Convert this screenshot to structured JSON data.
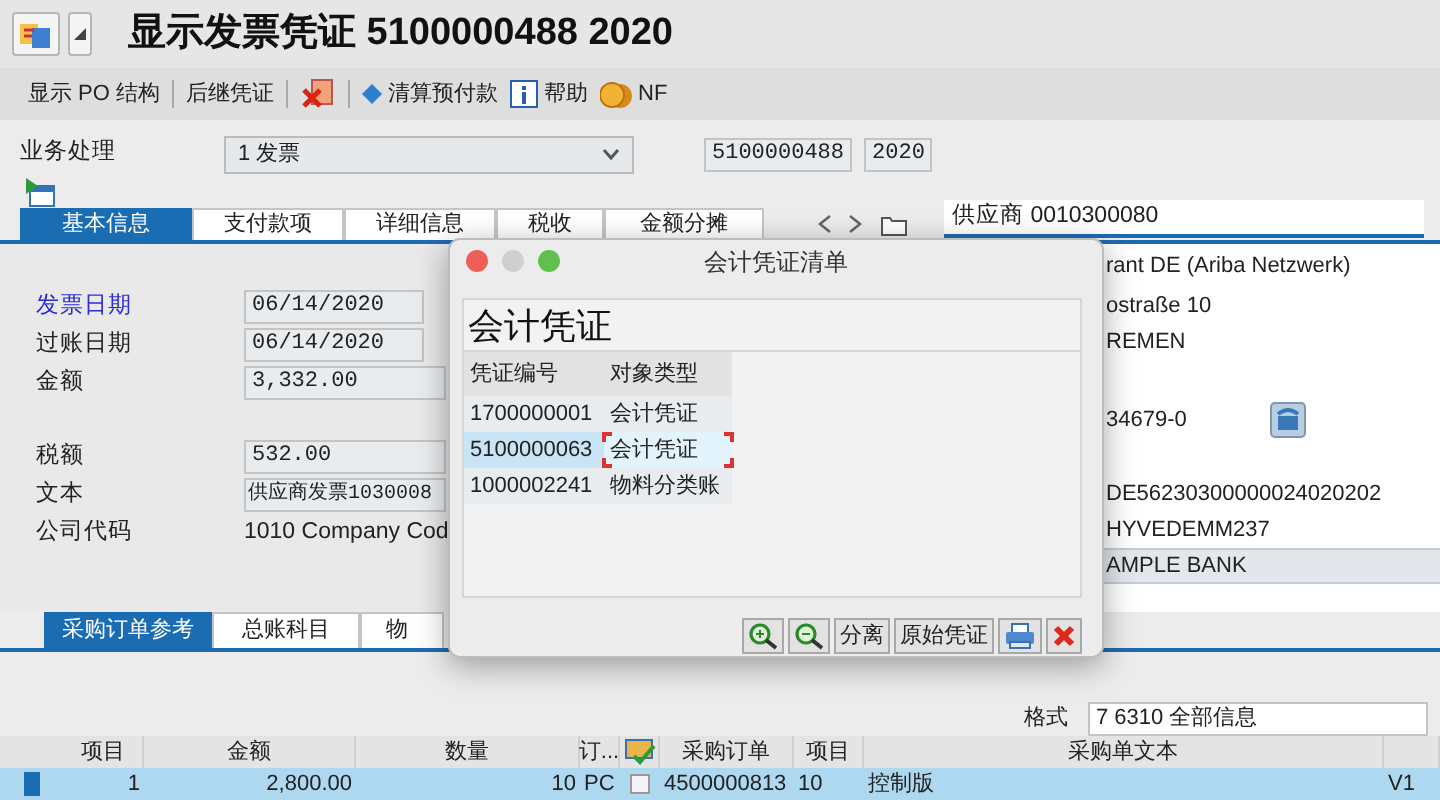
{
  "window": {
    "title": "显示发票凭证 5100000488 2020"
  },
  "toolbar": [
    {
      "kind": "text",
      "label": "显示 PO 结构"
    },
    {
      "kind": "separator"
    },
    {
      "kind": "text",
      "label": "后继凭证"
    },
    {
      "kind": "separator"
    },
    {
      "kind": "delete-icon"
    },
    {
      "kind": "separator"
    },
    {
      "kind": "diamond",
      "label": "清算预付款"
    },
    {
      "kind": "info",
      "label": "帮助"
    },
    {
      "kind": "coins",
      "label": "NF"
    }
  ],
  "header": {
    "transaction_label": "业务处理",
    "transaction_value": "1 发票",
    "doc_number": "5100000488",
    "year": "2020"
  },
  "tabs": [
    {
      "label": "基本信息",
      "selected": true
    },
    {
      "label": "支付款项",
      "selected": false
    },
    {
      "label": "详细信息",
      "selected": false
    },
    {
      "label": "税收",
      "selected": false
    },
    {
      "label": "金额分摊",
      "selected": false
    }
  ],
  "fields": [
    {
      "label": "发票日期",
      "value": "06/14/2020",
      "kind": "input",
      "required": true
    },
    {
      "label": "过账日期",
      "value": "06/14/2020",
      "kind": "input",
      "required": false
    },
    {
      "label": "金额",
      "value": "3,332.00",
      "kind": "input",
      "required": false
    },
    {
      "label": "税额",
      "value": "532.00",
      "kind": "input",
      "required": false
    },
    {
      "label": "文本",
      "value": "供应商发票1030008",
      "kind": "input",
      "required": false
    },
    {
      "label": "公司代码",
      "value": "1010 Company Cod",
      "kind": "text",
      "required": false
    }
  ],
  "vendor": {
    "field": "供应商 0010300080",
    "lines": [
      {
        "kind": "text",
        "text": "rant DE (Ariba Netzwerk)"
      },
      {
        "kind": "text",
        "text": "ostraße 10"
      },
      {
        "kind": "text",
        "text": "REMEN"
      },
      {
        "kind": "text-icon",
        "text": "34679-0"
      },
      {
        "kind": "text",
        "text": "DE56230300000024020202"
      },
      {
        "kind": "text",
        "text": "HYVEDEMM237"
      },
      {
        "kind": "highlight",
        "text": "AMPLE BANK"
      }
    ]
  },
  "dialog": {
    "title": "会计凭证清单",
    "heading": "会计凭证",
    "columns": [
      "凭证编号",
      "对象类型"
    ],
    "rows": [
      {
        "cells": [
          "1700000001",
          "会计凭证"
        ],
        "selected": false
      },
      {
        "cells": [
          "5100000063",
          "会计凭证"
        ],
        "selected": true
      },
      {
        "cells": [
          "1000002241",
          "物料分类账"
        ],
        "selected": false
      }
    ],
    "buttons": [
      {
        "kind": "zoom-in"
      },
      {
        "kind": "zoom-out"
      },
      {
        "kind": "text",
        "label": "分离"
      },
      {
        "kind": "text",
        "label": "原始凭证"
      },
      {
        "kind": "print"
      },
      {
        "kind": "close"
      }
    ]
  },
  "bottom_tabs": [
    {
      "label": "采购订单参考",
      "selected": true
    },
    {
      "label": "总账科目",
      "selected": false
    },
    {
      "label": "物",
      "selected": false
    }
  ],
  "layout_format": {
    "label": "格式",
    "value": "7 6310 全部信息"
  },
  "table": {
    "columns": [
      {
        "kind": "text",
        "label": "项目"
      },
      {
        "kind": "text",
        "label": "金额"
      },
      {
        "kind": "text",
        "label": "数量"
      },
      {
        "kind": "text",
        "label": "订..."
      },
      {
        "kind": "icon"
      },
      {
        "kind": "text",
        "label": "采购订单"
      },
      {
        "kind": "text",
        "label": "项目"
      },
      {
        "kind": "text",
        "label": "采购单文本"
      },
      {
        "kind": "blank"
      }
    ],
    "rows": [
      {
        "selected": true,
        "cells": [
          {
            "kind": "text",
            "text": "1"
          },
          {
            "kind": "text",
            "text": "2,800.00"
          },
          {
            "kind": "text",
            "text": "10"
          },
          {
            "kind": "text",
            "text": "PC"
          },
          {
            "kind": "checkbox",
            "checked": false
          },
          {
            "kind": "text",
            "text": "4500000813"
          },
          {
            "kind": "text",
            "text": "10"
          },
          {
            "kind": "text",
            "text": "控制版"
          },
          {
            "kind": "text",
            "text": "V1"
          }
        ]
      }
    ]
  }
}
